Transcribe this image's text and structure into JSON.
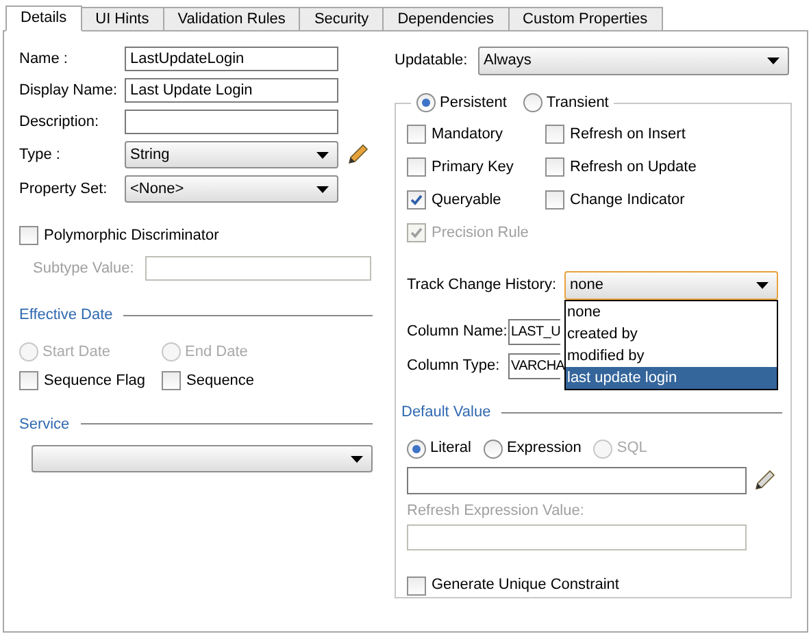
{
  "tabs": [
    {
      "label": "Details",
      "selected": true
    },
    {
      "label": "UI Hints",
      "selected": false
    },
    {
      "label": "Validation Rules",
      "selected": false
    },
    {
      "label": "Security",
      "selected": false
    },
    {
      "label": "Dependencies",
      "selected": false
    },
    {
      "label": "Custom Properties",
      "selected": false
    }
  ],
  "left": {
    "fields": [
      {
        "kind": "text",
        "label": "Name :",
        "value": "LastUpdateLogin"
      },
      {
        "kind": "text",
        "label": "Display Name:",
        "value": "Last Update Login"
      },
      {
        "kind": "text",
        "label": "Description:"
      },
      {
        "kind": "select",
        "label": "Type :",
        "value": "String",
        "edit_icon": true
      },
      {
        "kind": "select",
        "label": "Property Set:",
        "value": "<None>"
      }
    ],
    "polymorphic_discriminator": {
      "label": "Polymorphic Discriminator",
      "checked": false
    },
    "subtype_value": {
      "label": "Subtype Value:",
      "disabled": true
    },
    "effective_date": {
      "title": "Effective Date",
      "radios": [
        {
          "label": "Start Date",
          "selected": false,
          "disabled": true
        },
        {
          "label": "End Date",
          "selected": false,
          "disabled": true
        }
      ],
      "checkboxes": [
        {
          "label": "Sequence Flag",
          "checked": false
        },
        {
          "label": "Sequence",
          "checked": false
        }
      ]
    },
    "service": {
      "title": "Service"
    }
  },
  "right": {
    "updatable": {
      "label": "Updatable:",
      "value": "Always"
    },
    "persistence": [
      {
        "label": "Persistent",
        "selected": true
      },
      {
        "label": "Transient",
        "selected": false
      }
    ],
    "options": [
      {
        "label": "Mandatory",
        "checked": false,
        "disabled": false
      },
      {
        "label": "Refresh on Insert",
        "checked": false,
        "disabled": false
      },
      {
        "label": "Primary Key",
        "checked": false,
        "disabled": false
      },
      {
        "label": "Refresh on Update",
        "checked": false,
        "disabled": false
      },
      {
        "label": "Queryable",
        "checked": true,
        "disabled": false
      },
      {
        "label": "Change Indicator",
        "checked": false,
        "disabled": false
      },
      {
        "label": "Precision Rule",
        "checked": true,
        "disabled": true
      }
    ],
    "track_change_history": {
      "label": "Track Change History:",
      "value": "none",
      "options": [
        {
          "label": "none",
          "highlighted": false
        },
        {
          "label": "created by",
          "highlighted": false
        },
        {
          "label": "modified by",
          "highlighted": false
        },
        {
          "label": "last update login",
          "highlighted": true
        }
      ]
    },
    "column_name": {
      "label": "Column Name:",
      "value": "LAST_U"
    },
    "column_type": {
      "label": "Column Type:",
      "value": "VARCHA"
    },
    "default_value": {
      "title": "Default Value",
      "radios": [
        {
          "label": "Literal",
          "selected": true,
          "disabled": false
        },
        {
          "label": "Expression",
          "selected": false,
          "disabled": false
        },
        {
          "label": "SQL",
          "selected": false,
          "disabled": true
        }
      ],
      "refresh_label": "Refresh Expression Value:"
    },
    "generate_unique_constraint": {
      "label": "Generate Unique Constraint",
      "checked": false
    }
  }
}
